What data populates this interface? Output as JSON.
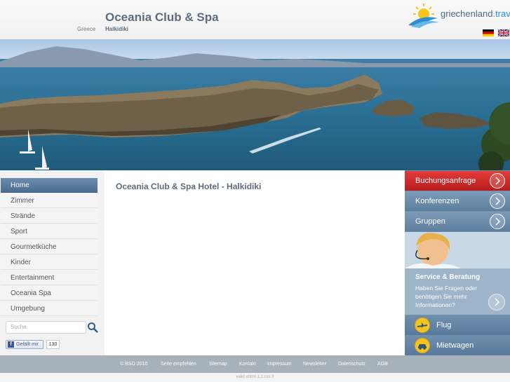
{
  "header": {
    "title": "Oceania Club & Spa",
    "breadcrumb_country": "Greece",
    "breadcrumb_region": "Halkidiki",
    "logo_text": "griechenland",
    "logo_tld": ".travel",
    "languages": [
      "german-flag",
      "english-flag"
    ]
  },
  "nav": {
    "items": [
      {
        "label": "Home"
      },
      {
        "label": "Zimmer"
      },
      {
        "label": "Strände"
      },
      {
        "label": "Sport"
      },
      {
        "label": "Gourmetküche"
      },
      {
        "label": "Kinder"
      },
      {
        "label": "Entertainment"
      },
      {
        "label": "Oceania Spa"
      },
      {
        "label": "Umgebung"
      }
    ],
    "active_index": 0
  },
  "search": {
    "placeholder": "Suche"
  },
  "social": {
    "like_label": "Gefällt mir",
    "like_count": "130"
  },
  "content": {
    "title": "Oceania Club & Spa Hotel - Halkidiki"
  },
  "sidebar": {
    "booking": "Buchungsanfrage",
    "conferences": "Konferenzen",
    "groups": "Gruppen",
    "service_title": "Service & Beratung",
    "service_text": "Haben Sie Fragen oder benötigen Sie mehr Informationen?",
    "flight": "Flug",
    "car": "Mietwagen"
  },
  "footer": {
    "links": [
      "© BSO 2010",
      "Seite empfehlen",
      "Sitemap",
      "Kontakt",
      "Impressum",
      "Newsletter",
      "Datenschutz",
      "AGB"
    ],
    "validation": "valid xhtml 1.1 css 3"
  },
  "colors": {
    "nav_active": "#5677a0",
    "booking_red": "#d12a2a",
    "sidebar_blue": "#6f8fae",
    "title_gray": "#5f6b7a",
    "footer_gray": "#a6b1ba"
  }
}
